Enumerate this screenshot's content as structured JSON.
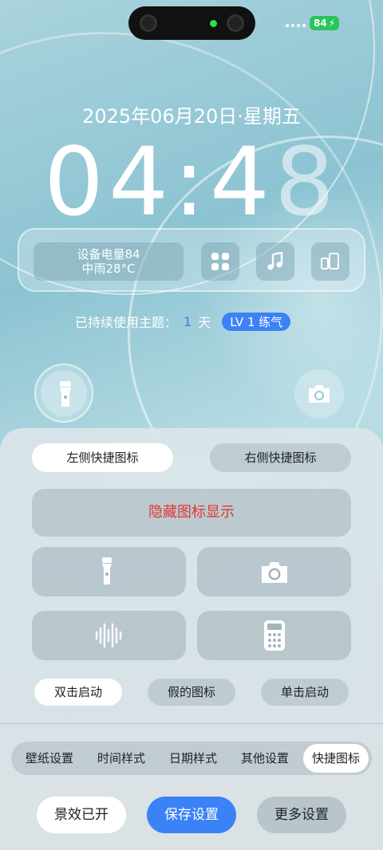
{
  "status": {
    "battery": "84"
  },
  "lock": {
    "date": "2025年06月20日·星期五",
    "time_main": "04:4",
    "time_last": "8"
  },
  "widget": {
    "device_battery": "设备电量84",
    "weather": "中雨28°C"
  },
  "theme": {
    "prefix": "已持续使用主题：",
    "days": "1",
    "unit": "天",
    "level": "LV 1  练气"
  },
  "sheet": {
    "tab_left": "左侧快捷图标",
    "tab_right": "右侧快捷图标",
    "hide_icon": "隐藏图标显示",
    "modes": [
      "双击启动",
      "假的图标",
      "单击启动"
    ],
    "settings_tabs": [
      "壁纸设置",
      "时间样式",
      "日期样式",
      "其他设置",
      "快捷图标"
    ],
    "actions": {
      "effects": "景效已开",
      "save": "保存设置",
      "more": "更多设置"
    }
  },
  "colors": {
    "accent": "#3b82f6",
    "warning_text": "#e03636"
  },
  "icons": [
    "flashlight-icon",
    "camera-icon",
    "apps-grid-icon",
    "music-icon",
    "devices-icon",
    "soundwave-icon",
    "calculator-icon"
  ]
}
